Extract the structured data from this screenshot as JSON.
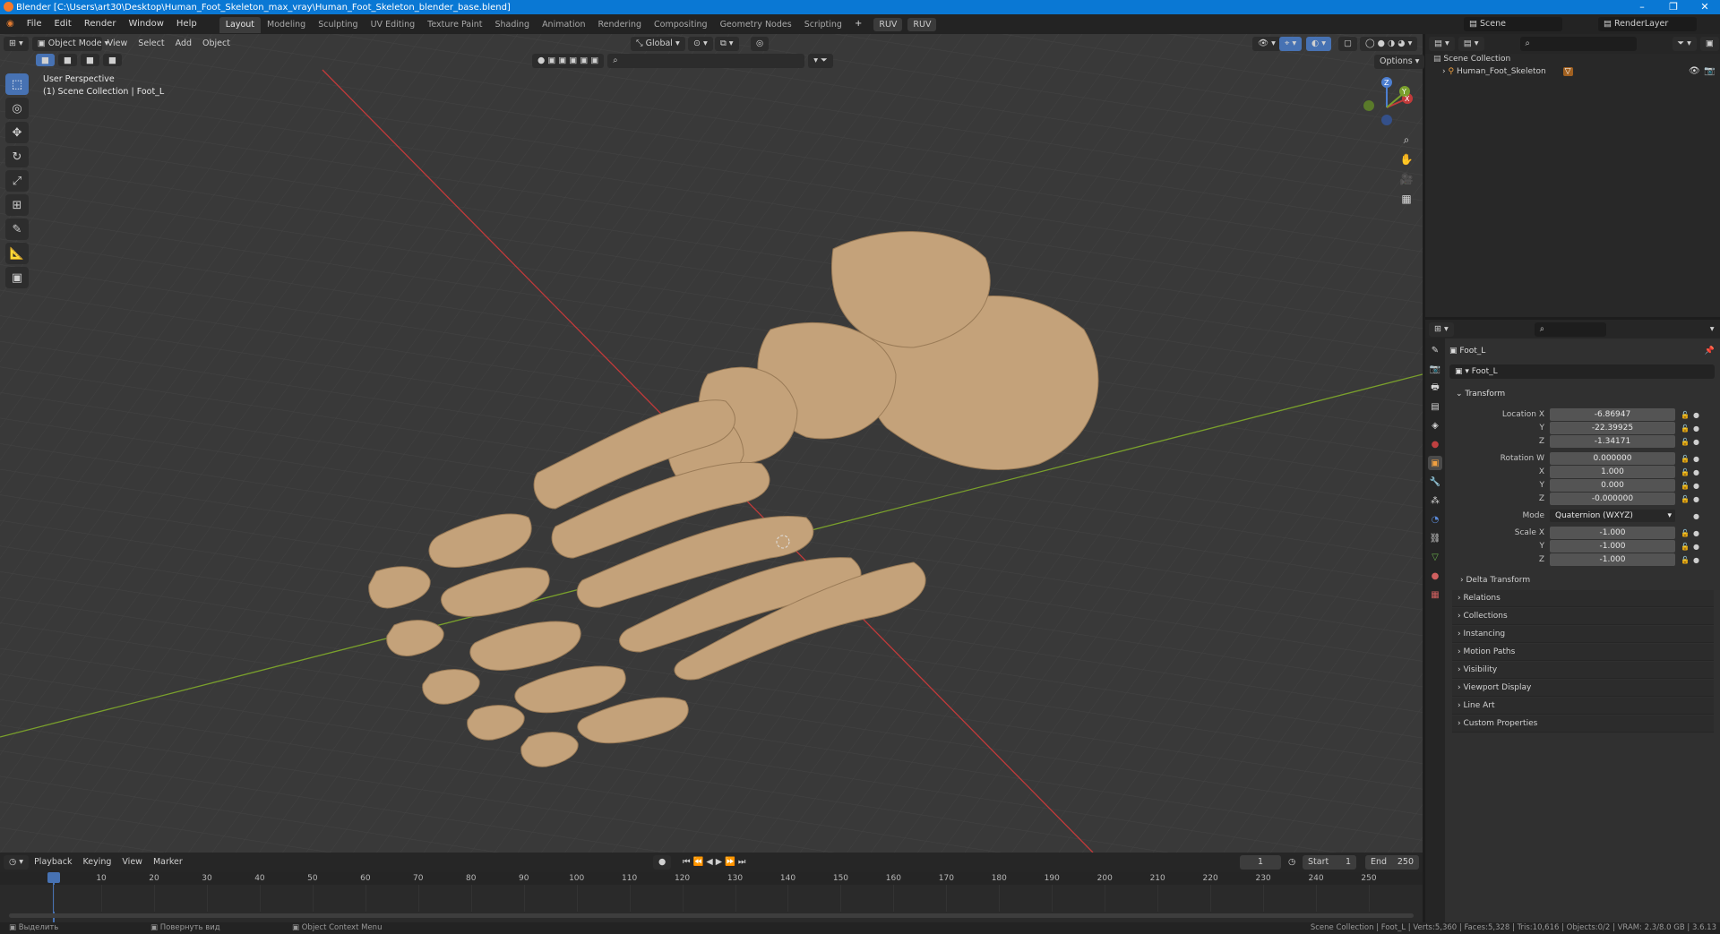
{
  "window": {
    "title": "Blender [C:\\Users\\art30\\Desktop\\Human_Foot_Skeleton_max_vray\\Human_Foot_Skeleton_blender_base.blend]",
    "controls": [
      "–",
      "❐",
      "✕"
    ]
  },
  "menu": [
    "File",
    "Edit",
    "Render",
    "Window",
    "Help"
  ],
  "workspaces": [
    "Layout",
    "Modeling",
    "Sculpting",
    "UV Editing",
    "Texture Paint",
    "Shading",
    "Animation",
    "Rendering",
    "Compositing",
    "Geometry Nodes",
    "Scripting"
  ],
  "active_workspace": "Layout",
  "ruv_buttons": [
    "RUV",
    "RUV"
  ],
  "scene": {
    "label": "Scene",
    "render_layer": "RenderLayer"
  },
  "viewport": {
    "mode": "Object Mode",
    "menus": [
      "View",
      "Select",
      "Add",
      "Object"
    ],
    "orientation": "Global",
    "options": "Options",
    "overlay_title": "User Perspective",
    "overlay_sub": "(1) Scene Collection | Foot_L",
    "gizmo_axes": {
      "x": "X",
      "y": "Y",
      "z": "Z"
    }
  },
  "tools": [
    "select-box",
    "cursor",
    "move",
    "rotate",
    "scale",
    "transform",
    "annotate",
    "measure",
    "add-cube"
  ],
  "timeline": {
    "menus": [
      "Playback",
      "Keying",
      "View",
      "Marker"
    ],
    "current_frame": "1",
    "start_label": "Start",
    "start": "1",
    "end_label": "End",
    "end": "250",
    "ticks": [
      "1",
      "10",
      "20",
      "30",
      "40",
      "50",
      "60",
      "70",
      "80",
      "90",
      "100",
      "110",
      "120",
      "130",
      "140",
      "150",
      "160",
      "170",
      "180",
      "190",
      "200",
      "210",
      "220",
      "230",
      "240",
      "250"
    ]
  },
  "status": {
    "left1": "Выделить",
    "left2": "Повернуть вид",
    "left3": "Object Context Menu",
    "right": "Scene Collection | Foot_L | Verts:5,360 | Faces:5,328 | Tris:10,616 | Objects:0/2 | VRAM: 2.3/8.0 GB | 3.6.13"
  },
  "outliner": {
    "root": "Scene Collection",
    "item": "Human_Foot_Skeleton"
  },
  "properties": {
    "object_name": "Foot_L",
    "data_name": "Foot_L",
    "transform_label": "Transform",
    "location_label": "Location X",
    "location": {
      "x": "-6.86947",
      "y": "-22.39925",
      "z": "-1.34171"
    },
    "rotation_label": "Rotation W",
    "rotation": {
      "w": "0.000000",
      "x": "1.000",
      "y": "0.000",
      "z": "-0.000000"
    },
    "mode_label": "Mode",
    "mode": "Quaternion (WXYZ)",
    "scale_label": "Scale X",
    "scale": {
      "x": "-1.000",
      "y": "-1.000",
      "z": "-1.000"
    },
    "axis_y": "Y",
    "axis_z": "Z",
    "axis_x": "X",
    "sections": [
      "Delta Transform",
      "Relations",
      "Collections",
      "Instancing",
      "Motion Paths",
      "Visibility",
      "Viewport Display",
      "Line Art",
      "Custom Properties"
    ]
  },
  "colors": {
    "accent": "#4772b3",
    "bone": "#c4a27a",
    "x_axis": "#c23a3a",
    "y_axis": "#7aa02c"
  }
}
